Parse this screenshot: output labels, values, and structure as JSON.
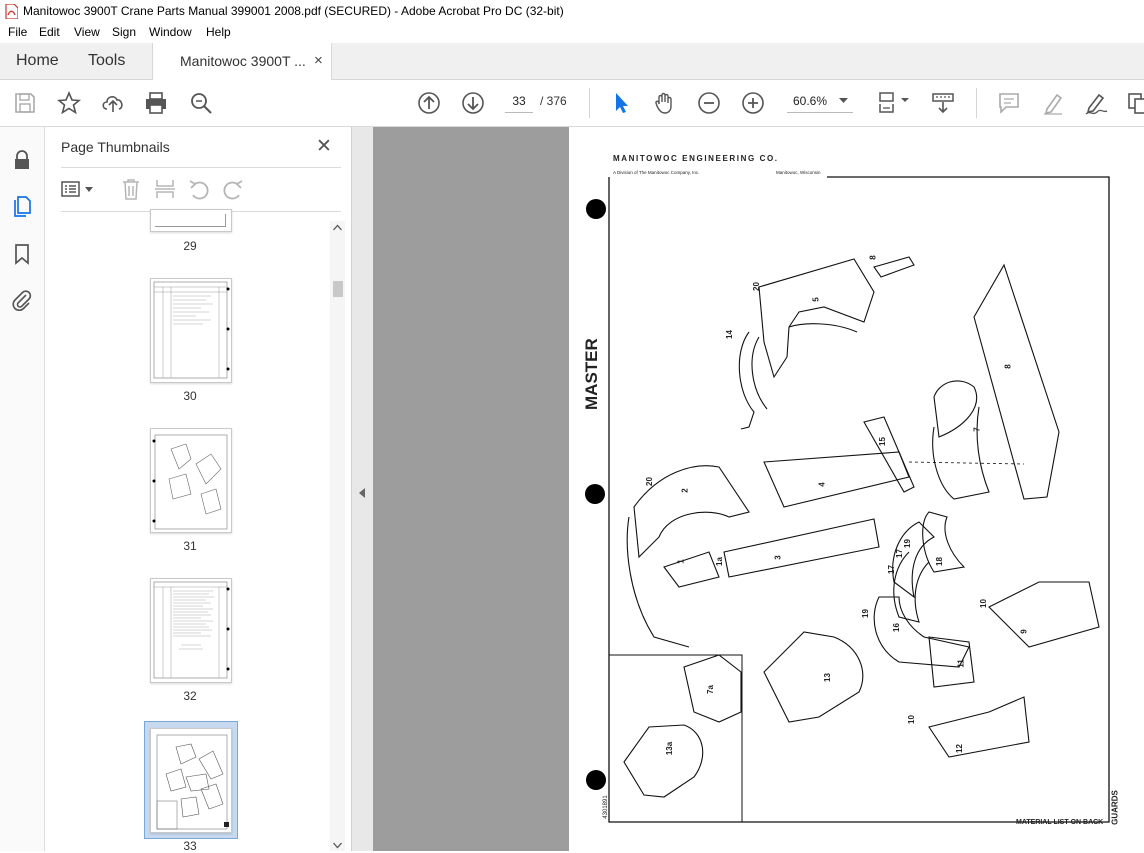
{
  "window": {
    "title": "Manitowoc 3900T Crane Parts Manual 399001 2008.pdf (SECURED) - Adobe Acrobat Pro DC (32-bit)"
  },
  "menu": [
    "File",
    "Edit",
    "View",
    "Sign",
    "Window",
    "Help"
  ],
  "tabs": {
    "home": "Home",
    "tools": "Tools",
    "document": "Manitowoc 3900T ...",
    "close_glyph": "×"
  },
  "toolbar": {
    "current_page": "33",
    "page_count": "/ 376",
    "zoom": "60.6%",
    "icons": [
      "save-icon",
      "bookmark-star-icon",
      "upload-icon",
      "print-icon",
      "zoom-search-icon",
      "prev-page-icon",
      "next-page-icon",
      "select-cursor-icon",
      "hand-icon",
      "zoom-out-icon",
      "zoom-in-icon",
      "zoom-dropdown-icon",
      "fit-page-icon",
      "scroll-mode-icon",
      "comment-icon",
      "highlight-icon",
      "sign-icon",
      "more-tools-icon"
    ]
  },
  "rail": {
    "icons": [
      "lock-icon",
      "page-thumbnails-icon",
      "bookmarks-icon",
      "attachments-icon"
    ]
  },
  "panel": {
    "title": "Page Thumbnails",
    "close_glyph": "✕",
    "thumbnails": [
      {
        "label": "29"
      },
      {
        "label": "30"
      },
      {
        "label": "31"
      },
      {
        "label": "32"
      },
      {
        "label": "33"
      }
    ]
  },
  "document": {
    "header": "MANITOWOC ENGINEERING CO.",
    "subheader_left": "A Division of The Manitowoc Company, Inc.",
    "subheader_right": "Manitowoc, Wisconsin",
    "side_label": "MASTER",
    "bottom_right": "MATERIAL LIST ON BACK",
    "right_vertical": "GUARDS",
    "drawing_number": "4301891",
    "part_numbers": [
      "20",
      "8",
      "5",
      "14",
      "8",
      "7",
      "15",
      "4",
      "2",
      "20",
      "1",
      "1a",
      "3",
      "17",
      "19",
      "17",
      "18",
      "10",
      "9",
      "19",
      "16",
      "13",
      "11",
      "7a",
      "13a",
      "10",
      "12"
    ]
  }
}
